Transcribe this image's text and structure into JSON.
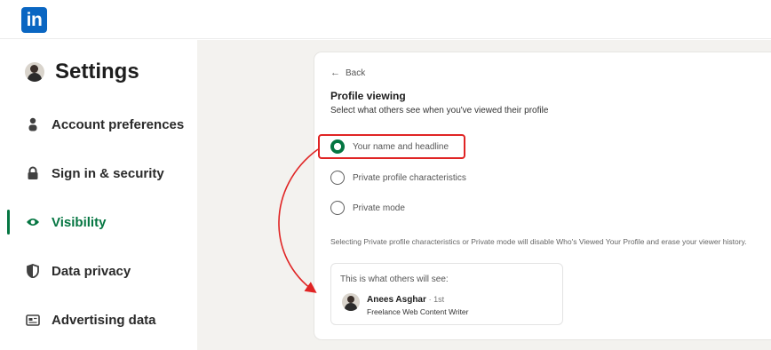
{
  "app": {
    "logo_text": "in",
    "brand_color": "#0a66c2",
    "accent_color": "#057642",
    "annotation_color": "#e02424"
  },
  "sidebar": {
    "title": "Settings",
    "items": [
      {
        "label": "Account preferences",
        "icon": "person-icon",
        "active": false
      },
      {
        "label": "Sign in & security",
        "icon": "lock-icon",
        "active": false
      },
      {
        "label": "Visibility",
        "icon": "eye-icon",
        "active": true
      },
      {
        "label": "Data privacy",
        "icon": "shield-icon",
        "active": false
      },
      {
        "label": "Advertising data",
        "icon": "newspaper-icon",
        "active": false
      }
    ]
  },
  "panel": {
    "back_label": "Back",
    "title": "Profile viewing",
    "subtitle": "Select what others see when you've viewed their profile",
    "options": [
      {
        "label": "Your name and headline",
        "selected": true
      },
      {
        "label": "Private profile characteristics",
        "selected": false
      },
      {
        "label": "Private mode",
        "selected": false
      }
    ],
    "note": "Selecting Private profile characteristics or Private mode will disable Who's Viewed Your Profile and erase your viewer history.",
    "preview": {
      "heading": "This is what others will see:",
      "name": "Anees Asghar",
      "degree": "· 1st",
      "headline": "Freelance Web Content Writer"
    }
  }
}
